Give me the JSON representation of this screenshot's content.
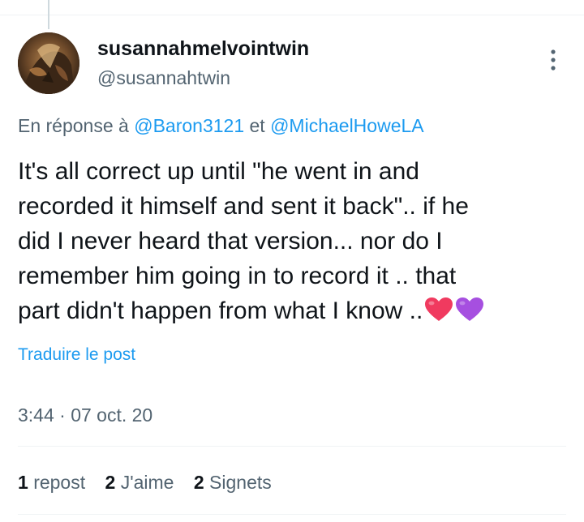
{
  "tweet": {
    "display_name": "susannahmelvointwin",
    "handle": "@susannahtwin",
    "reply_prefix": "En réponse à ",
    "reply_mention_1": "@Baron3121",
    "reply_joiner": " et ",
    "reply_mention_2": "@MichaelHoweLA",
    "text_lines": [
      "It's all correct up until \"he went in and",
      "recorded it himself and sent it back\".. if he",
      "did I never heard that version... nor  do I",
      "remember him going in to record it .. that",
      "part didn't happen from what I know .."
    ],
    "emojis": [
      "red-heart",
      "purple-heart"
    ],
    "translate_label": "Traduire le post",
    "timestamp": "3:44 · 07 oct. 20"
  },
  "stats": [
    {
      "count": "1",
      "label": "repost"
    },
    {
      "count": "2",
      "label": "J'aime"
    },
    {
      "count": "2",
      "label": "Signets"
    }
  ],
  "colors": {
    "text": "#0f1419",
    "secondary": "#536471",
    "link": "#1d9bf0",
    "divider": "#eff3f4",
    "red_heart": "#f03a5f",
    "purple_heart": "#a64fe0"
  },
  "icons": {
    "more": "more-vertical-icon",
    "avatar": "profile-avatar"
  }
}
